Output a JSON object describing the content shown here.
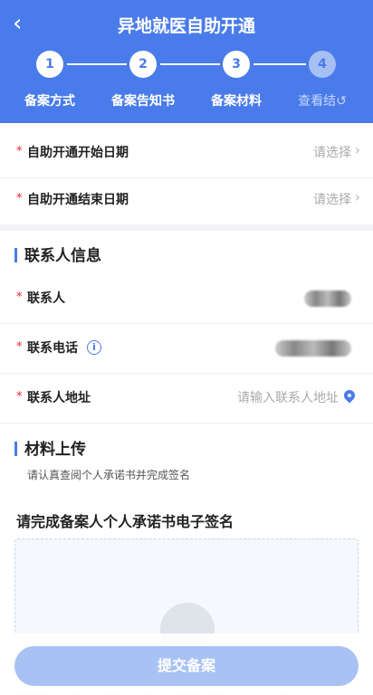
{
  "header": {
    "title": "异地就医自助开通",
    "back_icon": "back-arrow-icon"
  },
  "steps": [
    {
      "number": "1",
      "label": "备案方式"
    },
    {
      "number": "2",
      "label": "备案告知书"
    },
    {
      "number": "3",
      "label": "备案材料"
    },
    {
      "number": "4",
      "label": "查看结↺"
    }
  ],
  "dates": {
    "start_label": "自助开通开始日期",
    "start_value": "请选择",
    "end_label": "自助开通结束日期",
    "end_value": "请选择"
  },
  "contact": {
    "section_title": "联系人信息",
    "name_label": "联系人",
    "phone_label": "联系电话",
    "address_label": "联系人地址",
    "address_placeholder": "请输入联系人地址"
  },
  "upload": {
    "section_title": "材料上传",
    "hint": "请认真查阅个人承诺书并完成签名",
    "sign_title": "请完成备案人个人承诺书电子签名"
  },
  "footer": {
    "submit_label": "提交备案"
  },
  "colors": {
    "accent": "#4a7bea",
    "required": "#e23333",
    "submit_disabled": "#a9c2f4"
  }
}
